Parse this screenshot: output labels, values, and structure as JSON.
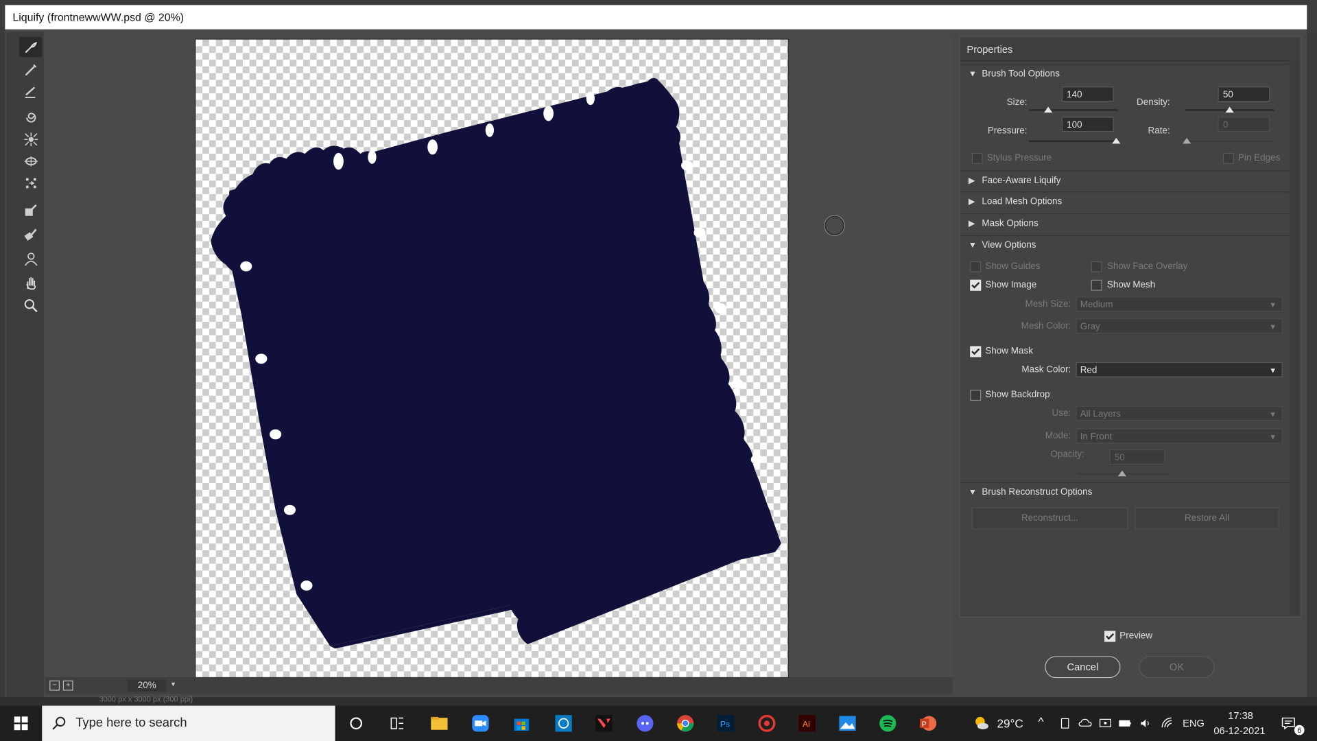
{
  "window": {
    "title": "Liquify (frontnewwWW.psd @ 20%)"
  },
  "tools": [
    "forward-warp",
    "reconstruct",
    "smooth",
    "twirl",
    "pucker",
    "bloat",
    "push-left",
    "freeze-mask",
    "thaw-mask",
    "face",
    "hand",
    "zoom"
  ],
  "zoom": {
    "value": "20%"
  },
  "status": {
    "text": "3000 px x 3000 px (300 ppi)"
  },
  "colors": {
    "shape_fill": "#11103a",
    "panel_bg": "#434343"
  },
  "properties": {
    "title": "Properties",
    "brush_tool": {
      "header": "Brush Tool Options",
      "size_label": "Size:",
      "size_value": "140",
      "density_label": "Density:",
      "density_value": "50",
      "pressure_label": "Pressure:",
      "pressure_value": "100",
      "rate_label": "Rate:",
      "rate_value": "0",
      "stylus_pressure": "Stylus Pressure",
      "pin_edges": "Pin Edges"
    },
    "face_aware": "Face-Aware Liquify",
    "load_mesh": "Load Mesh Options",
    "mask_options": "Mask Options",
    "view_options": {
      "header": "View Options",
      "show_guides": "Show Guides",
      "show_face_overlay": "Show Face Overlay",
      "show_image": "Show Image",
      "show_mesh": "Show Mesh",
      "mesh_size_label": "Mesh Size:",
      "mesh_size_value": "Medium",
      "mesh_color_label": "Mesh Color:",
      "mesh_color_value": "Gray",
      "show_mask": "Show Mask",
      "mask_color_label": "Mask Color:",
      "mask_color_value": "Red",
      "show_backdrop": "Show Backdrop",
      "use_label": "Use:",
      "use_value": "All Layers",
      "mode_label": "Mode:",
      "mode_value": "In Front",
      "opacity_label": "Opacity:",
      "opacity_value": "50"
    },
    "reconstruct": {
      "header": "Brush Reconstruct Options",
      "reconstruct_btn": "Reconstruct...",
      "restore_all_btn": "Restore All"
    }
  },
  "footer": {
    "preview": "Preview",
    "cancel": "Cancel",
    "ok": "OK"
  },
  "taskbar": {
    "search_placeholder": "Type here to search",
    "weather": "29°C",
    "lang": "ENG",
    "time": "17:38",
    "date": "06-12-2021",
    "notification_count": "6"
  }
}
